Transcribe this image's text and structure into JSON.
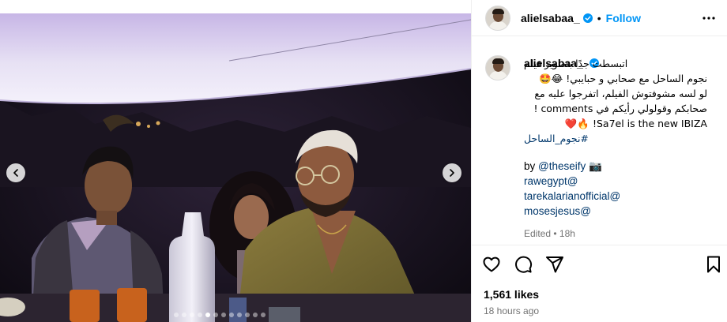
{
  "header": {
    "username": "alielsabaa_",
    "separator": "•",
    "follow_label": "Follow"
  },
  "caption": {
    "username": "alielsabaa_",
    "line1": "اتبسطت جدًا بتصوير فيلم",
    "line2": "نجوم الساحل مع صحابي و حبايبي! 😂🤩",
    "line3": "لو لسه مشوفتوش الفيلم، اتفرجوا عليه مع",
    "line4": "صحابكم وقولولي رأيكم في comments !",
    "line5": "Sa7el is the new IBIZA! 🔥❤️",
    "hashtag": "#نجوم_الساحل",
    "by_prefix": "by",
    "by_mention": "@theseify",
    "by_emoji": "📷",
    "mentions": [
      "rawegypt@",
      "tarekalarianofficial@",
      "mosesjesus@"
    ],
    "edited": "Edited • 18h"
  },
  "icons": {
    "more": "more-horizontal-icon",
    "like": "heart-icon",
    "comment": "comment-icon",
    "share": "send-icon",
    "save": "bookmark-icon",
    "verified": "verified-badge-icon"
  },
  "footer": {
    "likes": "1,561 likes",
    "time": "18 hours ago"
  },
  "carousel": {
    "slide_count": 12,
    "active_index": 4
  },
  "colors": {
    "link": "#0095f6",
    "mention": "#00376b",
    "muted": "#737373",
    "verified": "#0095f6"
  }
}
